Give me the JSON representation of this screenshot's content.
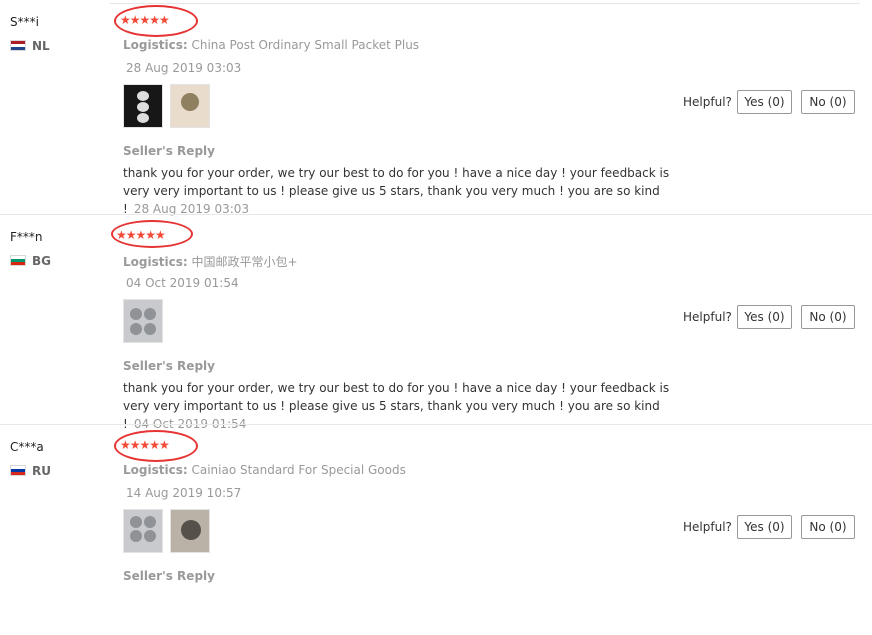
{
  "helpful_label": "Helpful?",
  "seller_reply_label": "Seller's Reply",
  "logistics_label": "Logistics:",
  "rating_icon": "star-icon",
  "reviews": [
    {
      "user": "S***i",
      "country": "NL",
      "rating": 5,
      "stars": "★★★★★",
      "logistics": "China Post Ordinary Small Packet Plus",
      "date": "28 Aug 2019 03:03",
      "reply": "thank you for your order, we try our best to do for you ! have a nice day ! your feedback is very very important to us ! please give us 5 stars, thank you very much ! you are so kind !",
      "reply_date": "28 Aug 2019 03:03",
      "yes": "Yes (0)",
      "no": "No (0)"
    },
    {
      "user": "F***n",
      "country": "BG",
      "rating": 5,
      "stars": "★★★★★",
      "logistics": "中国邮政平常小包+",
      "date": "04 Oct 2019 01:54",
      "reply": "thank you for your order, we try our best to do for you ! have a nice day ! your feedback is very very important to us ! please give us 5 stars, thank you very much ! you are so kind !",
      "reply_date": "04 Oct 2019 01:54",
      "yes": "Yes (0)",
      "no": "No (0)"
    },
    {
      "user": "C***a",
      "country": "RU",
      "rating": 5,
      "stars": "★★★★★",
      "logistics": "Cainiao Standard For Special Goods",
      "date": "14 Aug 2019 10:57",
      "yes": "Yes (0)",
      "no": "No (0)"
    }
  ],
  "colors": {
    "star": "#f34a38",
    "annotation_ring": "#e63333"
  }
}
